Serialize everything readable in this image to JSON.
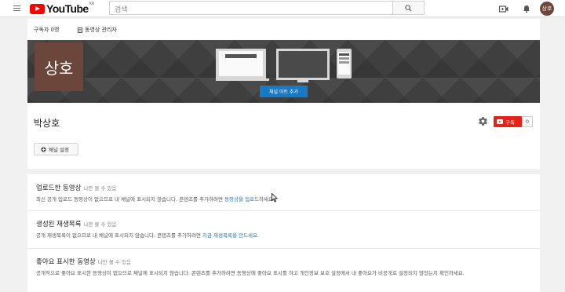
{
  "masthead": {
    "logo_text": "YouTube",
    "region": "KR",
    "search_placeholder": "검색",
    "avatar_text": "상호"
  },
  "channel_bar": {
    "subscriber_count": "구독자 0명",
    "video_manager": "동영상 관리자"
  },
  "banner": {
    "avatar_text": "상호",
    "add_art_label": "채널 아트 추가"
  },
  "channel_header": {
    "name": "박상호",
    "subscribe_label": "구독",
    "subscribe_count": "0",
    "settings_label": "채널 설정"
  },
  "sections": {
    "uploads": {
      "title": "업로드한 동영상",
      "visibility": "나만 볼 수 있음",
      "desc_before": "최신 공개 업로드 동영상이 없으므로 내 채널에 표시되지 않습니다. 콘텐츠를 추가하려면 ",
      "desc_link": "동영상을 업로드",
      "desc_after": "하세요."
    },
    "playlists": {
      "title": "생성된 재생목록",
      "visibility": "나만 볼 수 있음",
      "desc_before": "공개 재생목록이 없으므로 내 채널에 표시되지 않습니다. 콘텐츠를 추가하려면 ",
      "desc_link": "지금 재생목록을 만드세요",
      "desc_after": "."
    },
    "liked": {
      "title": "좋아요 표시한 동영상",
      "visibility": "나만 볼 수 있음",
      "desc": "공개적으로 좋아요 표시한 동영상이 없으므로 채널에 표시되지 않습니다. 콘텐츠를 추가하려면 동영상에 좋아요 표시를 하고 개인정보 보호 설정에서 내 좋아요가 비공개로 설정되지 않았는지 확인하세요."
    }
  },
  "colors": {
    "brand_red": "#ff0000",
    "subscribe_red": "#e62117",
    "link_blue": "#167ac6",
    "avatar_brown": "#6c463a",
    "banner_gray": "#3f3f3f"
  },
  "icons": [
    "menu-icon",
    "search-icon",
    "video-camera-icon",
    "bell-icon",
    "document-icon",
    "gear-icon",
    "plus-circle-icon",
    "mouse-cursor-icon"
  ]
}
